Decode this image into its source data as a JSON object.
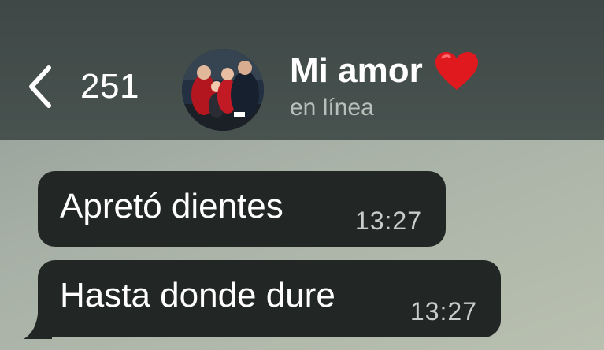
{
  "header": {
    "back_count": "251",
    "chat_title": "Mi amor",
    "status": "en línea"
  },
  "messages": [
    {
      "text": "Apretó dientes",
      "time": "13:27"
    },
    {
      "text": "Hasta donde dure",
      "time": "13:27"
    }
  ],
  "colors": {
    "header_bg": "#434c4a",
    "bubble_bg": "#222624",
    "heart": "#e0191f"
  },
  "icons": {
    "back": "chevron-left-icon",
    "heart": "heart-icon"
  }
}
